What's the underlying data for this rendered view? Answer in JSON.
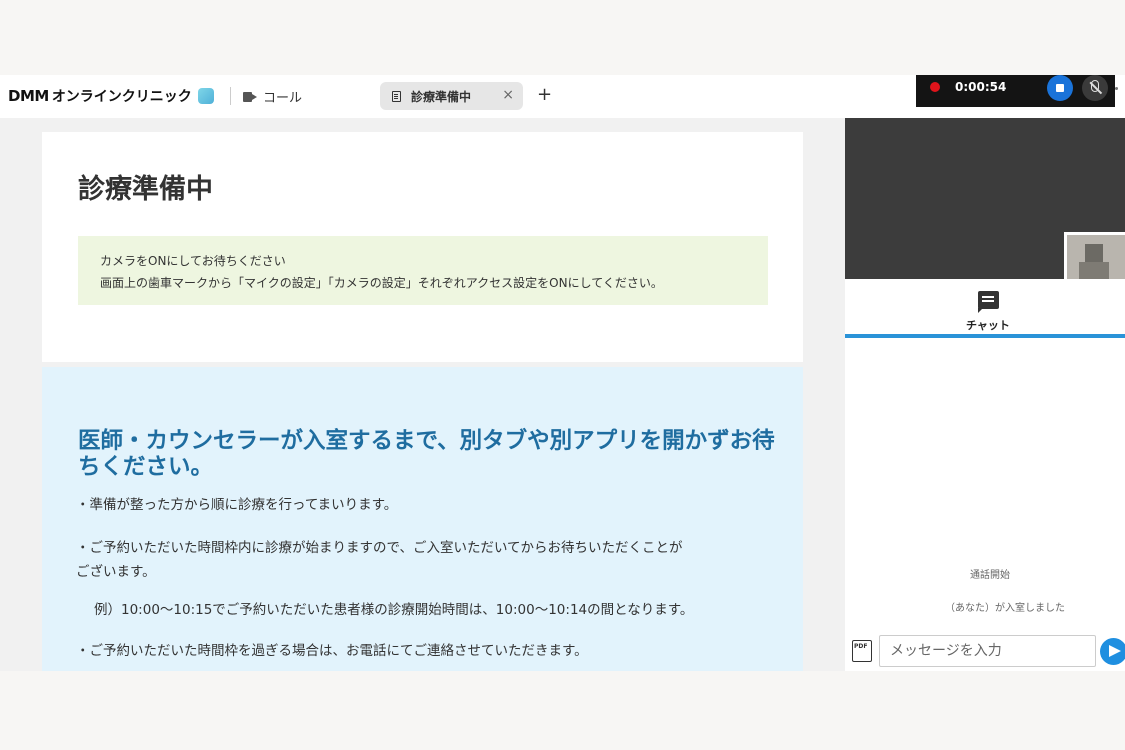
{
  "header": {
    "logo_brand": "DMM",
    "logo_text": "オンラインクリニック",
    "call_tab_label": "コール",
    "active_tab_label": "診療準備中",
    "close_glyph": "×",
    "add_glyph": "+"
  },
  "recording": {
    "elapsed": "0:00:54",
    "dot_color": "#e0141b"
  },
  "main": {
    "title": "診療準備中",
    "notice_line1": "カメラをONにしてお待ちください",
    "notice_line2": "画面上の歯車マークから「マイクの設定」「カメラの設定」それぞれアクセス設定をONにしてください。",
    "headline": "医師・カウンセラーが入室するまで、別タブや別アプリを開かずお待ちください。",
    "para1": "・準備が整った方から順に診療を行ってまいります。",
    "para2a": "・ご予約いただいた時間枠内に診療が始まりますので、ご入室いただいてからお待ちいただくことが",
    "para2b": "ございます。",
    "para3": "例）10:00〜10:15でご予約いただいた患者様の診療開始時間は、10:00〜10:14の間となります。",
    "para4": "・ご予約いただいた時間枠を過ぎる場合は、お電話にてご連絡させていただきます。"
  },
  "sidebar": {
    "chat_tab_label": "チャット",
    "system_msg1": "通話開始",
    "system_msg2": "（あなた）が入室しました",
    "pdf_label": "PDF",
    "input_placeholder": "メッセージを入力",
    "accent_color": "#2a93d8"
  }
}
